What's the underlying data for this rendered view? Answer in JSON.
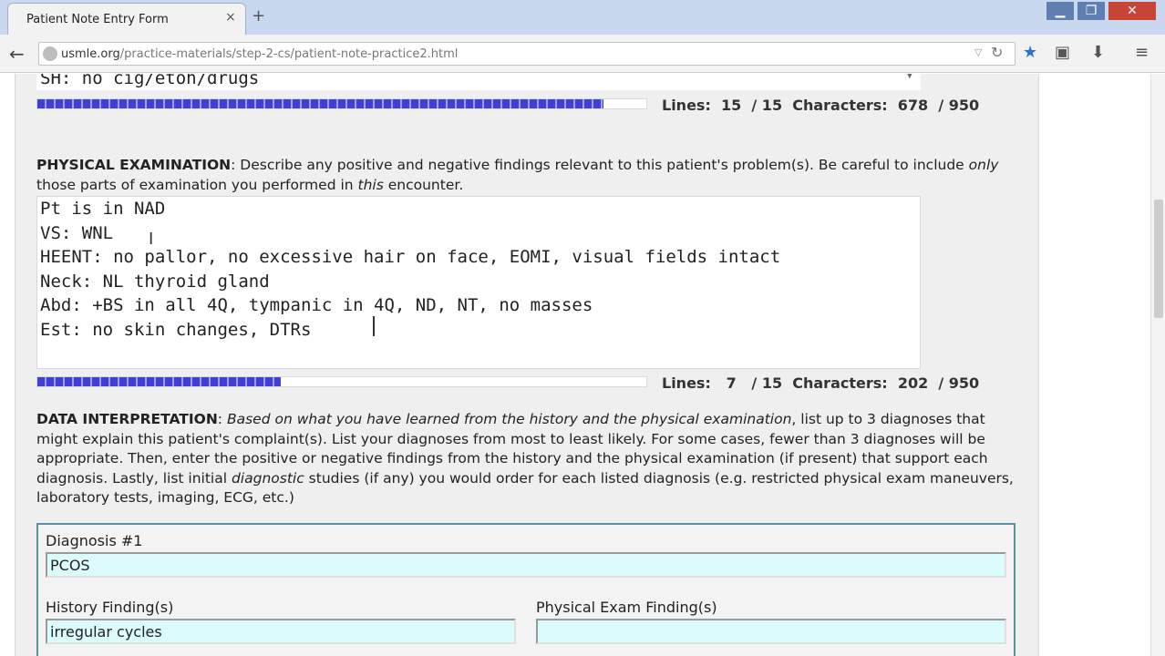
{
  "browser": {
    "tab_title": "Patient Note Entry Form",
    "new_tab": "+",
    "close_tab": "×",
    "url_host": "usmle.org",
    "url_path": "/practice-materials/step-2-cs/patient-note-practice2.html",
    "icons": [
      "back-icon",
      "globe-icon",
      "reload-icon",
      "star-icon",
      "clipboard-icon",
      "download-icon",
      "menu-icon"
    ]
  },
  "social_history": {
    "text": "SH: no cig/etoh/drugs"
  },
  "history_counter": {
    "progress": 0.93,
    "lines_label": "Lines:",
    "lines_value": "15",
    "lines_max": "/ 15",
    "chars_label": "Characters:",
    "chars_value": "678",
    "chars_max": "/ 950"
  },
  "physical_exam": {
    "heading": "PHYSICAL EXAMINATION",
    "desc_a": ": Describe any positive and negative findings relevant to this patient's problem(s). Be careful to include ",
    "desc_only": "only",
    "desc_b": " those parts of examination you performed in ",
    "desc_this": "this",
    "desc_c": " encounter.",
    "lines": [
      "Pt is in NAD",
      "VS: WNL",
      "HEENT: no pallor, no excessive hair on face, EOMI, visual fields intact",
      "Neck: NL thyroid gland",
      "Abd: +BS in all 4Q, tympanic in 4Q, ND, NT, no masses",
      "Est: no skin changes, DTRs "
    ]
  },
  "pe_counter": {
    "progress": 0.4,
    "lines_label": "Lines:",
    "lines_value": "7",
    "lines_max": "/ 15",
    "chars_label": "Characters:",
    "chars_value": "202",
    "chars_max": "/ 950"
  },
  "data_interpretation": {
    "heading": "DATA INTERPRETATION",
    "desc_a": ": ",
    "desc_italic": "Based on what you have learned from the history and the physical examination",
    "desc_b": ", list up to 3 diagnoses that might explain this patient's complaint(s). List your diagnoses from most to least likely. For some cases, fewer than 3 diagnoses will be appropriate. Then, enter the positive or negative findings from the history and the physical examination (if present) that support each diagnosis. Lastly, list initial ",
    "desc_diag": "diagnostic",
    "desc_c": " studies (if any) you would order for each listed diagnosis (e.g. restricted physical exam maneuvers, laboratory tests, imaging, ECG, etc.)"
  },
  "diagnosis1": {
    "label": "Diagnosis #1",
    "value": "PCOS",
    "history_label": "History Finding(s)",
    "history_value": "irregular cycles",
    "pe_label": "Physical Exam Finding(s)",
    "pe_value": ""
  }
}
